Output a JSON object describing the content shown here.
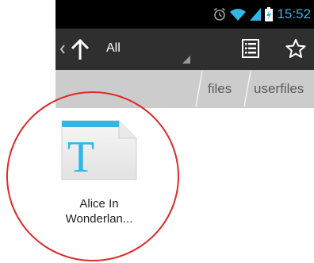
{
  "status_bar": {
    "time": "15:52",
    "icons": [
      "alarm-icon",
      "wifi-icon",
      "signal-icon",
      "battery-charging-icon"
    ],
    "accent_color": "#33b5e5"
  },
  "action_bar": {
    "back_icon": "chevron-left-icon",
    "up_icon": "up-arrow-icon",
    "spinner_label": "All",
    "buttons": [
      "list-view-icon",
      "star-icon"
    ]
  },
  "breadcrumbs": [
    "files",
    "userfiles"
  ],
  "files": [
    {
      "name": "Alice In\nWonderlan...",
      "icon": "text-document-icon",
      "icon_letter": "T"
    }
  ],
  "annotation": {
    "shape": "circle",
    "color": "#e02929"
  }
}
